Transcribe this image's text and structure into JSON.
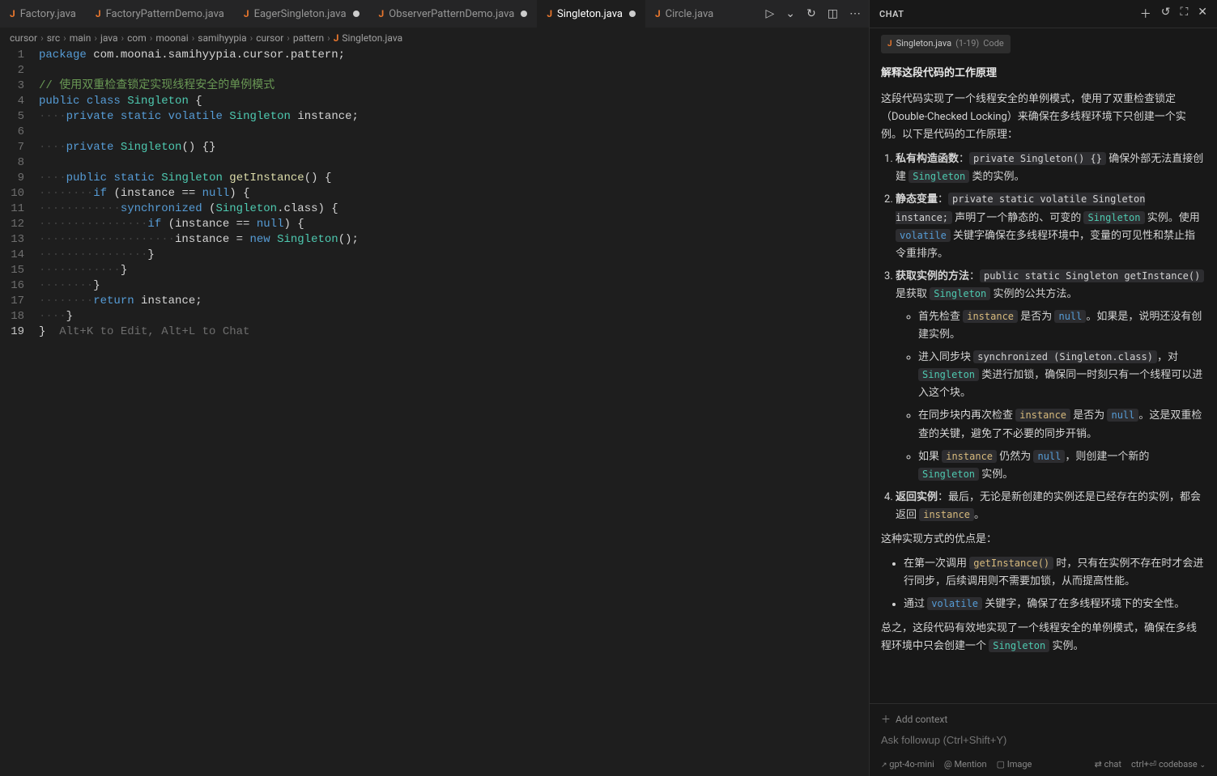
{
  "tabs": [
    {
      "label": "Factory.java",
      "active": false,
      "dirty": false
    },
    {
      "label": "FactoryPatternDemo.java",
      "active": false,
      "dirty": false
    },
    {
      "label": "EagerSingleton.java",
      "active": false,
      "dirty": true
    },
    {
      "label": "ObserverPatternDemo.java",
      "active": false,
      "dirty": true
    },
    {
      "label": "Singleton.java",
      "active": true,
      "dirty": true
    },
    {
      "label": "Circle.java",
      "active": false,
      "dirty": false
    }
  ],
  "breadcrumb": [
    "cursor",
    "src",
    "main",
    "java",
    "com",
    "moonai",
    "samihyypia",
    "cursor",
    "pattern",
    "Singleton.java"
  ],
  "code": {
    "hint": "Alt+K to Edit, Alt+L to Chat",
    "lines": [
      {
        "n": 1,
        "t": "package",
        "content": "com.moonai.samihyypia.cursor.pattern"
      },
      {
        "n": 2
      },
      {
        "n": 3,
        "comment": "// 使用双重检查锁定实现线程安全的单例模式"
      },
      {
        "n": 4
      },
      {
        "n": 5
      },
      {
        "n": 6
      },
      {
        "n": 7
      },
      {
        "n": 8
      },
      {
        "n": 9
      },
      {
        "n": 10
      },
      {
        "n": 11
      },
      {
        "n": 12
      },
      {
        "n": 13
      },
      {
        "n": 14
      },
      {
        "n": 15
      },
      {
        "n": 16
      },
      {
        "n": 17
      },
      {
        "n": 18
      },
      {
        "n": 19
      }
    ]
  },
  "chat": {
    "title": "CHAT",
    "context_file": "Singleton.java",
    "context_range": "(1-19)",
    "context_badge": "Code",
    "question": "解释这段代码的工作原理",
    "intro": "这段代码实现了一个线程安全的单例模式，使用了双重检查锁定（Double-Checked Locking）来确保在多线程环境下只创建一个实例。以下是代码的工作原理：",
    "items": {
      "i1_label": "私有构造函数",
      "i1_code": "private Singleton() {}",
      "i1_text_a": " 确保外部无法直接创建 ",
      "i1_code2": "Singleton",
      "i1_text_b": " 类的实例。",
      "i2_label": "静态变量",
      "i2_code": "private static volatile Singleton instance;",
      "i2_text_a": " 声明了一个静态的、可变的 ",
      "i2_code2": "Singleton",
      "i2_text_b": " 实例。使用 ",
      "i2_code3": "volatile",
      "i2_text_c": " 关键字确保在多线程环境中，变量的可见性和禁止指令重排序。",
      "i3_label": "获取实例的方法",
      "i3_code": "public static Singleton getInstance()",
      "i3_text_a": " 是获取 ",
      "i3_code2": "Singleton",
      "i3_text_b": " 实例的公共方法。",
      "b1_a": "首先检查 ",
      "b1_code": "instance",
      "b1_b": " 是否为 ",
      "b1_code2": "null",
      "b1_c": "。如果是，说明还没有创建实例。",
      "b2_a": "进入同步块 ",
      "b2_code": "synchronized (Singleton.class)",
      "b2_b": "，对 ",
      "b2_code2": "Singleton",
      "b2_c": " 类进行加锁，确保同一时刻只有一个线程可以进入这个块。",
      "b3_a": "在同步块内再次检查 ",
      "b3_code": "instance",
      "b3_b": " 是否为 ",
      "b3_code2": "null",
      "b3_c": "。这是双重检查的关键，避免了不必要的同步开销。",
      "b4_a": "如果 ",
      "b4_code": "instance",
      "b4_b": " 仍然为 ",
      "b4_code2": "null",
      "b4_c": "，则创建一个新的 ",
      "b4_code3": "Singleton",
      "b4_d": " 实例。",
      "i4_label": "返回实例",
      "i4_text_a": "：最后，无论是新创建的实例还是已经存在的实例，都会返回 ",
      "i4_code": "instance",
      "i4_text_b": "。"
    },
    "advantages_intro": "这种实现方式的优点是：",
    "adv1_a": "在第一次调用 ",
    "adv1_code": "getInstance()",
    "adv1_b": " 时，只有在实例不存在时才会进行同步，后续调用则不需要加锁，从而提高性能。",
    "adv2_a": "通过 ",
    "adv2_code": "volatile",
    "adv2_b": " 关键字，确保了在多线程环境下的安全性。",
    "summary_a": "总之，这段代码有效地实现了一个线程安全的单例模式，确保在多线程环境中只会创建一个 ",
    "summary_code": "Singleton",
    "summary_b": " 实例。",
    "add_context": "Add context",
    "placeholder": "Ask followup (Ctrl+Shift+Y)",
    "model": "gpt-4o-mini",
    "mention": "@ Mention",
    "image": "Image",
    "chat_btn": "chat",
    "codebase": "codebase",
    "ctrl_enter": "ctrl+⏎"
  }
}
